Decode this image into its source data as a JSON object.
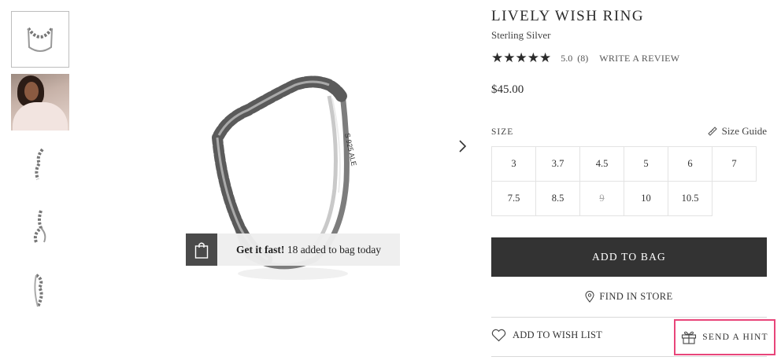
{
  "gallery": {
    "thumbnails": [
      {
        "icon": "ring-front-thumbnail"
      },
      {
        "icon": "model-photo-thumbnail"
      },
      {
        "icon": "ring-side-thumbnail"
      },
      {
        "icon": "ring-angle-thumbnail"
      },
      {
        "icon": "ring-back-thumbnail"
      }
    ],
    "ring_engraving": "S 925 ALE"
  },
  "toast": {
    "bold": "Get it fast!",
    "text": " 18 added to bag today"
  },
  "product": {
    "title": "LIVELY WISH RING",
    "material": "Sterling Silver",
    "stars": "★★★★★",
    "rating": "5.0",
    "review_count": "(8)",
    "write_review": "WRITE A REVIEW",
    "price": "$45.00"
  },
  "size": {
    "label": "SIZE",
    "guide_label": "Size Guide",
    "options": [
      {
        "value": "3",
        "available": true
      },
      {
        "value": "3.7",
        "available": true
      },
      {
        "value": "4.5",
        "available": true
      },
      {
        "value": "5",
        "available": true
      },
      {
        "value": "6",
        "available": true
      },
      {
        "value": "7",
        "available": true
      },
      {
        "value": "7.5",
        "available": true
      },
      {
        "value": "8.5",
        "available": true
      },
      {
        "value": "9",
        "available": false
      },
      {
        "value": "10",
        "available": true
      },
      {
        "value": "10.5",
        "available": true
      }
    ]
  },
  "actions": {
    "add_to_bag": "ADD TO BAG",
    "find_in_store": "FIND IN STORE",
    "add_to_wishlist": "ADD TO WISH LIST",
    "send_hint": "SEND A HINT"
  },
  "colors": {
    "button_dark": "#333333",
    "highlight": "#e8457a"
  }
}
